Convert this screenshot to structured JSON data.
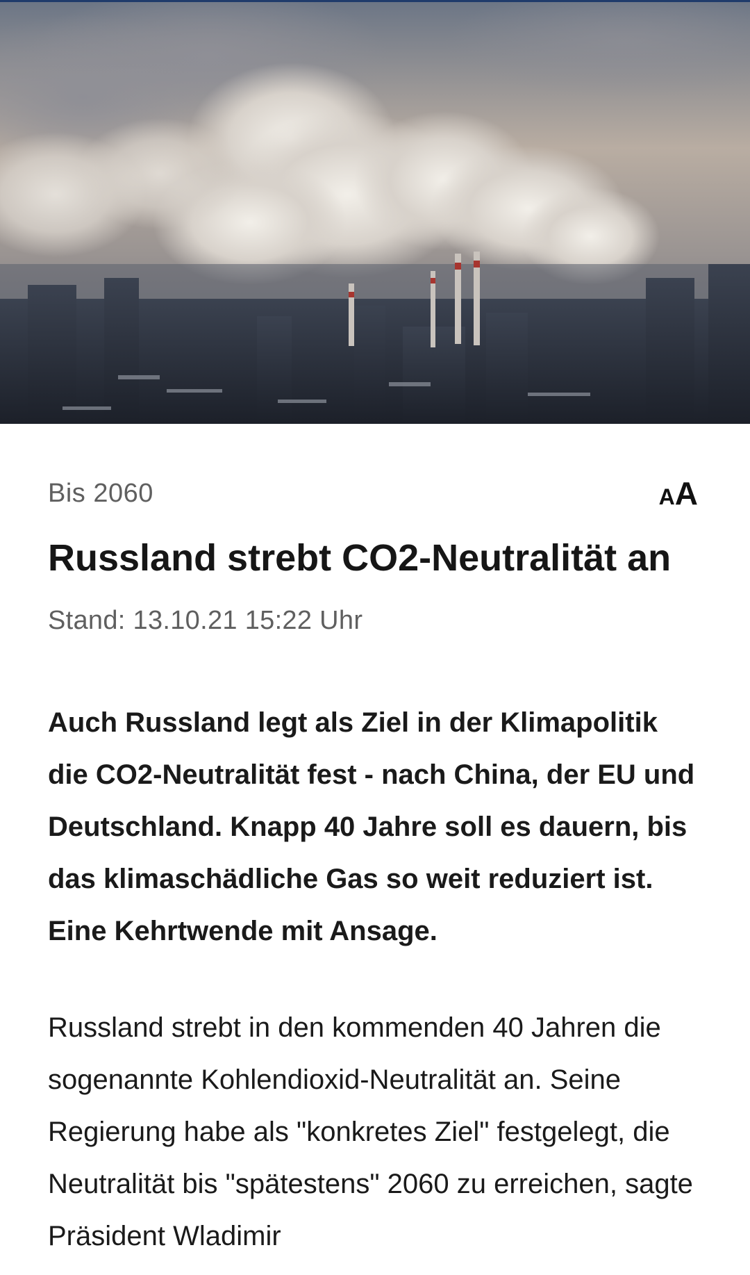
{
  "hero_image": {
    "description_icon": "industrial-city-smog-photo"
  },
  "article": {
    "kicker": "Bis 2060",
    "font_size_toggle": {
      "small": "A",
      "big": "A"
    },
    "headline": "Russland strebt CO2-Neutralität an",
    "stand": "Stand: 13.10.21 15:22 Uhr",
    "lead": "Auch Russland legt als Ziel in der Klimapolitik die CO2-Neutralität fest - nach China, der EU und Deutschland. Knapp 40 Jahre soll es dauern, bis das klimaschädliche Gas so weit reduziert ist. Eine Kehrtwende mit Ansage.",
    "body": "Russland strebt in den kommenden 40 Jahren die sogenannte Kohlendioxid-Neutralität an. Seine Regierung habe als \"konkretes Ziel\" festgelegt, die Neutralität bis \"spätestens\" 2060 zu erreichen, sagte Präsident Wladimir"
  },
  "colors": {
    "top_line": "#1f3b6b",
    "muted_text": "#5f5f5f",
    "text": "#1a1a1a"
  }
}
